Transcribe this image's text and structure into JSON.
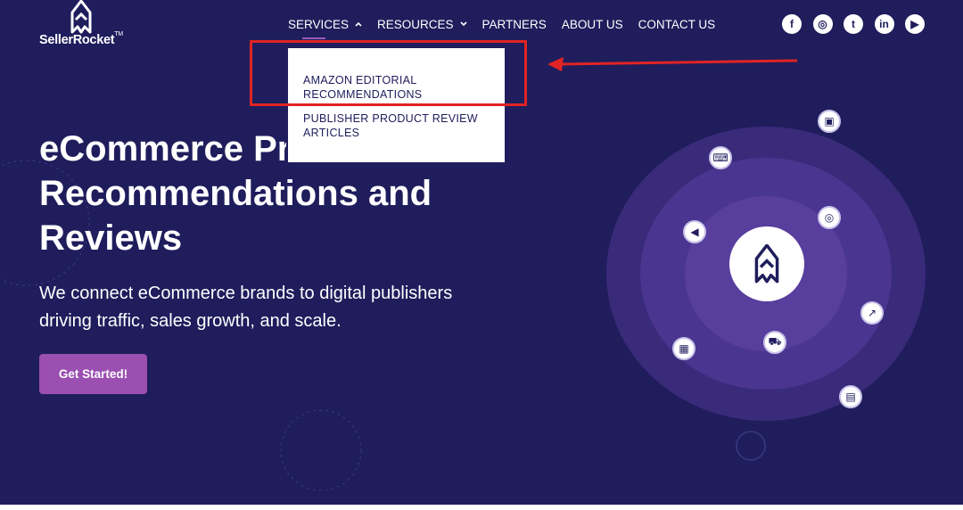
{
  "brand": {
    "name": "SellerRocket",
    "trademark": "TM"
  },
  "nav": {
    "items": [
      {
        "label": "SERVICES",
        "has_dropdown": true,
        "expanded": true
      },
      {
        "label": "RESOURCES",
        "has_dropdown": true,
        "expanded": false
      },
      {
        "label": "PARTNERS"
      },
      {
        "label": "ABOUT US"
      },
      {
        "label": "CONTACT US"
      }
    ]
  },
  "socials": [
    {
      "icon": "facebook-icon",
      "glyph": "f"
    },
    {
      "icon": "instagram-icon",
      "glyph": "◎"
    },
    {
      "icon": "twitter-icon",
      "glyph": "t"
    },
    {
      "icon": "linkedin-icon",
      "glyph": "in"
    },
    {
      "icon": "youtube-icon",
      "glyph": "▶"
    }
  ],
  "services_dropdown": {
    "items": [
      {
        "label": "AMAZON EDITORIAL RECOMMENDATIONS",
        "highlighted": true
      },
      {
        "label": "PUBLISHER PRODUCT REVIEW ARTICLES",
        "highlighted": false
      }
    ]
  },
  "hero": {
    "title_line_1": "eCommerce Product",
    "title_line_2": "Recommendations and",
    "title_line_3": "Reviews",
    "subtitle": "We connect eCommerce brands to digital publishers driving traffic, sales growth, and scale.",
    "cta_label": "Get Started!"
  },
  "orbit_icons": [
    "id-card-icon",
    "keyboard-icon",
    "target-icon",
    "megaphone-icon",
    "growth-chart-icon",
    "shopping-cart-icon",
    "storefront-icon",
    "chat-icon"
  ],
  "colors": {
    "background": "#1f1d5c",
    "accent": "#9b4fb0",
    "annotation_red": "#e02424",
    "text": "#ffffff"
  }
}
